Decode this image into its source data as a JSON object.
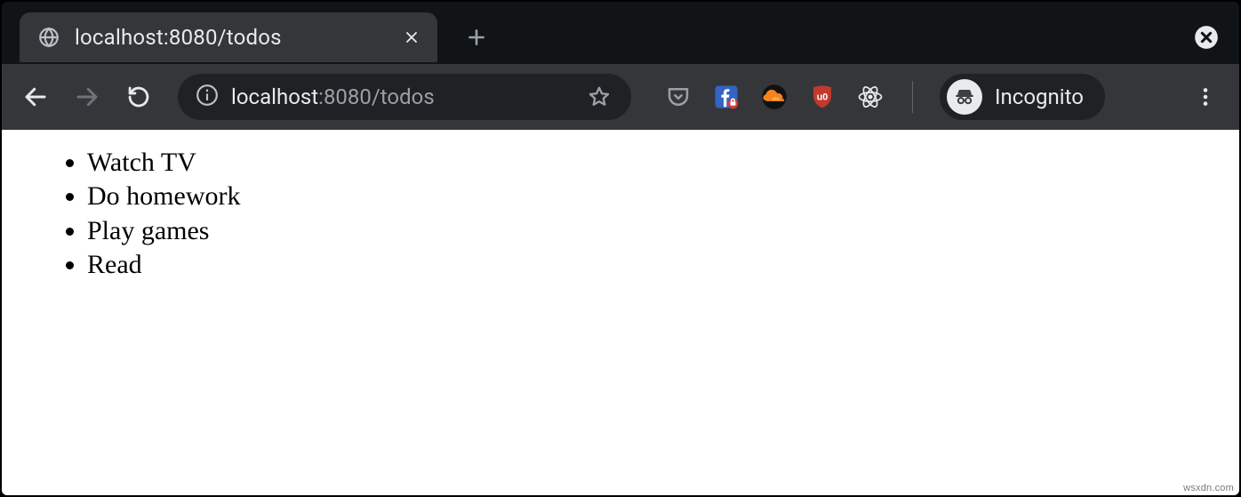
{
  "tab": {
    "title": "localhost:8080/todos"
  },
  "address": {
    "host": "localhost",
    "path": ":8080/todos"
  },
  "incognito": {
    "label": "Incognito"
  },
  "extensions": [
    {
      "name": "pocket"
    },
    {
      "name": "facebook-container"
    },
    {
      "name": "cloudflare"
    },
    {
      "name": "ublock-origin"
    },
    {
      "name": "react-devtools"
    }
  ],
  "todos": [
    "Watch TV",
    "Do homework",
    "Play games",
    "Read"
  ],
  "watermark": "wsxdn.com"
}
